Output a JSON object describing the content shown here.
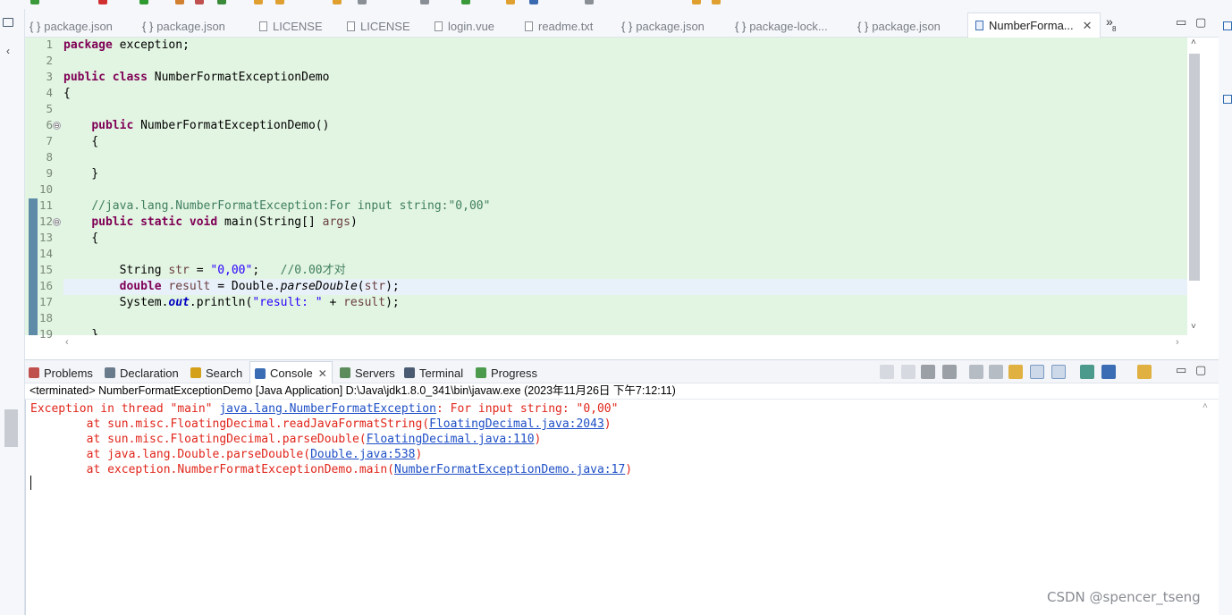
{
  "editor_tabs": [
    {
      "label": "package.json",
      "icon": "json-braces-icon"
    },
    {
      "label": "package.json",
      "icon": "json-braces-icon"
    },
    {
      "label": "LICENSE",
      "icon": "text-file-icon"
    },
    {
      "label": "LICENSE",
      "icon": "text-file-icon"
    },
    {
      "label": "login.vue",
      "icon": "text-file-icon"
    },
    {
      "label": "readme.txt",
      "icon": "text-file-icon"
    },
    {
      "label": "package.json",
      "icon": "json-braces-icon"
    },
    {
      "label": "package-lock...",
      "icon": "json-braces-icon"
    },
    {
      "label": "package.json",
      "icon": "json-braces-icon"
    },
    {
      "label": "NumberForma...",
      "icon": "java-file-icon",
      "active": true
    }
  ],
  "tabs_overflow": {
    "symbol": "»",
    "count": "8"
  },
  "glyphs": {
    "braces": "{ }",
    "close": "✕",
    "minimize": "▭",
    "maximize": "▢",
    "left_arrow": "‹",
    "right_arrow": "›",
    "up_arrow": "˄",
    "down_arrow": "˅",
    "fold": "⊖"
  },
  "editor": {
    "line_numbers": [
      "1",
      "2",
      "3",
      "4",
      "5",
      "6",
      "7",
      "8",
      "9",
      "10",
      "11",
      "12",
      "13",
      "14",
      "15",
      "16",
      "17",
      "18",
      "19"
    ],
    "current_line": 16,
    "lines": [
      {
        "parts": [
          {
            "t": "package",
            "c": "kw"
          },
          {
            "t": " exception;",
            "c": ""
          }
        ]
      },
      {
        "parts": []
      },
      {
        "parts": [
          {
            "t": "public",
            "c": "kw"
          },
          {
            "t": " ",
            "c": ""
          },
          {
            "t": "class",
            "c": "kw"
          },
          {
            "t": " NumberFormatExceptionDemo",
            "c": ""
          }
        ]
      },
      {
        "parts": [
          {
            "t": "{",
            "c": ""
          }
        ]
      },
      {
        "parts": []
      },
      {
        "parts": [
          {
            "t": "    ",
            "c": ""
          },
          {
            "t": "public",
            "c": "kw"
          },
          {
            "t": " NumberFormatExceptionDemo()",
            "c": ""
          }
        ]
      },
      {
        "parts": [
          {
            "t": "    {",
            "c": ""
          }
        ]
      },
      {
        "parts": []
      },
      {
        "parts": [
          {
            "t": "    }",
            "c": ""
          }
        ]
      },
      {
        "parts": []
      },
      {
        "parts": [
          {
            "t": "    ",
            "c": ""
          },
          {
            "t": "//java.lang.NumberFormatException:For input string:\"0,00\"",
            "c": "cm"
          }
        ]
      },
      {
        "parts": [
          {
            "t": "    ",
            "c": ""
          },
          {
            "t": "public",
            "c": "kw"
          },
          {
            "t": " ",
            "c": ""
          },
          {
            "t": "static",
            "c": "kw"
          },
          {
            "t": " ",
            "c": ""
          },
          {
            "t": "void",
            "c": "kw"
          },
          {
            "t": " main(String[] ",
            "c": ""
          },
          {
            "t": "args",
            "c": "lv"
          },
          {
            "t": ")",
            "c": ""
          }
        ]
      },
      {
        "parts": [
          {
            "t": "    {",
            "c": ""
          }
        ]
      },
      {
        "parts": []
      },
      {
        "parts": [
          {
            "t": "        String ",
            "c": ""
          },
          {
            "t": "str",
            "c": "lv"
          },
          {
            "t": " = ",
            "c": ""
          },
          {
            "t": "\"0,00\"",
            "c": "st"
          },
          {
            "t": ";   ",
            "c": ""
          },
          {
            "t": "//0.00才对",
            "c": "cm"
          }
        ]
      },
      {
        "parts": [
          {
            "t": "        ",
            "c": ""
          },
          {
            "t": "double",
            "c": "kw"
          },
          {
            "t": " ",
            "c": ""
          },
          {
            "t": "result",
            "c": "lv"
          },
          {
            "t": " = Double.",
            "c": ""
          },
          {
            "t": "parseDouble",
            "c": "it"
          },
          {
            "t": "(",
            "c": ""
          },
          {
            "t": "str",
            "c": "lv"
          },
          {
            "t": ");",
            "c": ""
          }
        ]
      },
      {
        "parts": [
          {
            "t": "        System.",
            "c": ""
          },
          {
            "t": "out",
            "c": "fi"
          },
          {
            "t": ".println(",
            "c": ""
          },
          {
            "t": "\"result: \"",
            "c": "st"
          },
          {
            "t": " + ",
            "c": ""
          },
          {
            "t": "result",
            "c": "lv"
          },
          {
            "t": ");",
            "c": ""
          }
        ]
      },
      {
        "parts": []
      },
      {
        "parts": [
          {
            "t": "    }",
            "c": ""
          }
        ]
      }
    ]
  },
  "panel_tabs": [
    {
      "label": "Problems",
      "icon": "problems-icon",
      "color": "#c0504d"
    },
    {
      "label": "Declaration",
      "icon": "declaration-icon",
      "color": "#6a7b8c"
    },
    {
      "label": "Search",
      "icon": "search-icon",
      "color": "#d4a017"
    },
    {
      "label": "Console",
      "icon": "console-icon",
      "color": "#3b6db4",
      "active": true
    },
    {
      "label": "Servers",
      "icon": "servers-icon",
      "color": "#5c8c5c"
    },
    {
      "label": "Terminal",
      "icon": "terminal-icon",
      "color": "#4a5a70"
    },
    {
      "label": "Progress",
      "icon": "progress-icon",
      "color": "#4c9a4c"
    }
  ],
  "console": {
    "header": "<terminated> NumberFormatExceptionDemo [Java Application] D:\\Java\\jdk1.8.0_341\\bin\\javaw.exe  (2023年11月26日 下午7:12:11)",
    "lines": [
      {
        "parts": [
          {
            "t": "Exception in thread \"main\" ",
            "link": false
          },
          {
            "t": "java.lang.NumberFormatException",
            "link": true
          },
          {
            "t": ": For input string: \"0,00\"",
            "link": false
          }
        ]
      },
      {
        "parts": [
          {
            "t": "        at sun.misc.FloatingDecimal.readJavaFormatString(",
            "link": false
          },
          {
            "t": "FloatingDecimal.java:2043",
            "link": true
          },
          {
            "t": ")",
            "link": false
          }
        ]
      },
      {
        "parts": [
          {
            "t": "        at sun.misc.FloatingDecimal.parseDouble(",
            "link": false
          },
          {
            "t": "FloatingDecimal.java:110",
            "link": true
          },
          {
            "t": ")",
            "link": false
          }
        ]
      },
      {
        "parts": [
          {
            "t": "        at java.lang.Double.parseDouble(",
            "link": false
          },
          {
            "t": "Double.java:538",
            "link": true
          },
          {
            "t": ")",
            "link": false
          }
        ]
      },
      {
        "parts": [
          {
            "t": "        at exception.NumberFormatExceptionDemo.main(",
            "link": false
          },
          {
            "t": "NumberFormatExceptionDemo.java:17",
            "link": true
          },
          {
            "t": ")",
            "link": false
          }
        ]
      }
    ]
  },
  "watermark": "CSDN @spencer_tseng",
  "colors": {
    "editor_bg": "#e2f4e2",
    "keyword": "#7f0055",
    "comment": "#3f7f5f",
    "string": "#2a00ff",
    "error": "#e0261b",
    "link": "#1e4fc6"
  }
}
